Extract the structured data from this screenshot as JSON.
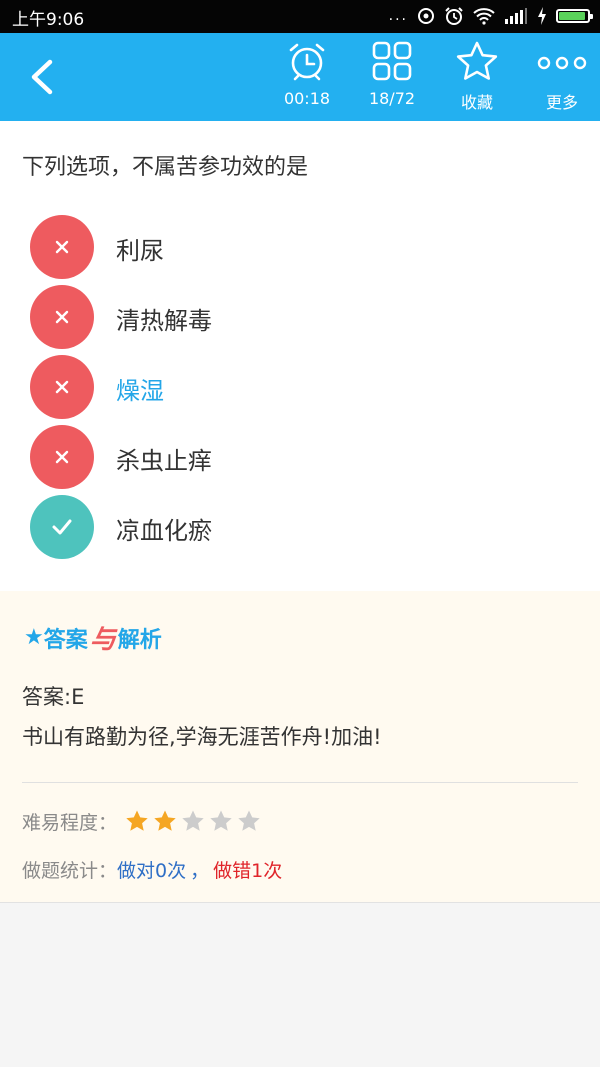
{
  "status_bar": {
    "time": "上午9:06",
    "dots": "...",
    "battery_level": 1.0,
    "battery_color": "#5ad25a"
  },
  "toolbar": {
    "timer": "00:18",
    "progress": "18/72",
    "favorite": "收藏",
    "more": "更多",
    "bg_color": "#23b0f0"
  },
  "question": {
    "text": "下列选项，不属苦参功效的是",
    "options": [
      {
        "label": "利尿",
        "status": "wrong"
      },
      {
        "label": "清热解毒",
        "status": "wrong"
      },
      {
        "label": "燥湿",
        "status": "wrong",
        "selected": true
      },
      {
        "label": "杀虫止痒",
        "status": "wrong"
      },
      {
        "label": "凉血化瘀",
        "status": "correct"
      }
    ]
  },
  "analysis": {
    "title_star": "★",
    "title_a": "答案",
    "title_and": "与",
    "title_b": "解析",
    "answer": "答案:E",
    "message": "书山有路勤为径,学海无涯苦作舟!加油!",
    "difficulty_label": "难易程度：",
    "difficulty_rating": 2,
    "difficulty_max": 5,
    "stats_label": "做题统计：",
    "stats_right": "做对0次",
    "stats_sep": "，",
    "stats_wrong": "做错1次"
  },
  "colors": {
    "wrong": "#ee5b5f",
    "correct": "#4ec3bd",
    "accent": "#23a6e8",
    "star_on": "#f5a623",
    "star_off": "#cccccc"
  }
}
